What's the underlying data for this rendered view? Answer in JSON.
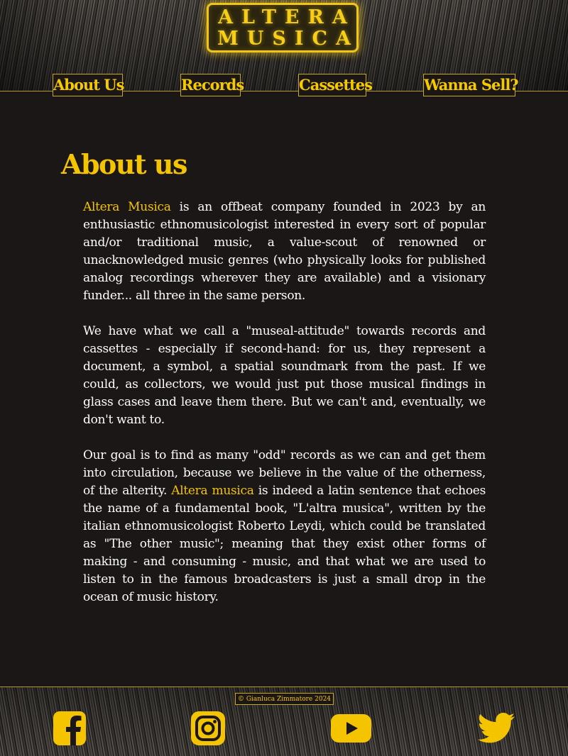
{
  "header": {
    "logo": {
      "line1": "ALTERA",
      "line2": "MUSICA"
    },
    "nav": [
      {
        "label": "About Us"
      },
      {
        "label": "Records"
      },
      {
        "label": "Cassettes"
      },
      {
        "label": "Wanna Sell?"
      }
    ]
  },
  "main": {
    "title": "About us",
    "paragraphs": [
      {
        "highlight": "Altera Musica",
        "text": " is an offbeat company founded in 2023 by an enthusiastic ethnomusicologist interested in every sort of popular and/or traditional music, a value-scout of renowned or unacknowledged music genres (who physically looks for published analog recordings wherever they are available) and a visionary funder... all three in the same person."
      },
      {
        "text": "We have what we call a \"museal-attitude\" towards records and cassettes - especially if second-hand: for us, they represent a document, a symbol, a spatial soundmark from the past. If we could, as collectors, we would just put those musical findings in glass cases and leave them there. But we can't and, eventually, we don't want to."
      },
      {
        "text_before": "Our goal is to find as many \"odd\" records as we can and get them into circulation, because we believe in the value of the otherness, of the alterity. ",
        "highlight": "Altera musica",
        "text_after": " is indeed a latin sentence that echoes the name of a fundamental book, \"L'altra musica\", written by the italian ethnomusicologist Roberto Leydi, which could be translated as \"The other music\"; meaning that they exist other forms of making - and consuming - music, and that what we are used to listen to in the famous broadcasters is just a small drop in the ocean of music history."
      }
    ]
  },
  "footer": {
    "copyright": "© Gianluca Zimmatore 2024",
    "social": [
      {
        "icon": "facebook-icon"
      },
      {
        "icon": "instagram-icon"
      },
      {
        "icon": "youtube-icon"
      },
      {
        "icon": "twitter-icon"
      }
    ]
  },
  "colors": {
    "accent": "#f5c400",
    "background": "#1c1717",
    "text": "#ffffff",
    "border": "#c9a816"
  }
}
